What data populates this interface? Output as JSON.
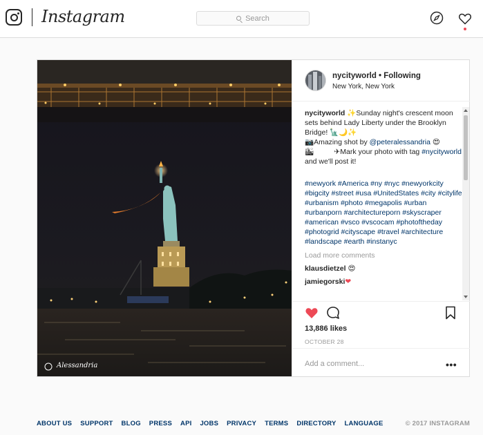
{
  "header": {
    "wordmark": "Instagram",
    "search_placeholder": "Search",
    "icons": [
      "instagram-camera-icon",
      "search-icon",
      "compass-icon",
      "heart-icon"
    ]
  },
  "post": {
    "photo_watermark": "Alessandria",
    "username": "nycityworld",
    "following": "• Following",
    "location": "New York, New York",
    "caption": {
      "username": "nycityworld",
      "line1": " ✨Sunday night's crescent moon sets behind Lady Liberty under the Brooklyn Bridge! 🗽🌙✨",
      "shot_prefix": "📷Amazing shot by ",
      "mention": "@peteralessandria",
      "shot_suffix": " 😍",
      "tag_prefix": "🏙          ✈Mark your photo with tag ",
      "tag_link": "#nycityworld",
      "tag_suffix": " and we'll post it!",
      "hashtags": "#newyork #America #ny #nyc #newyorkcity #bigcity #street #usa #UnitedStates #city #citylife #urbanism #photo #megapolis #urban #urbanporn #architectureporn #skyscraper #american #vsco #vscocam #photoftheday #photogrid #cityscape #travel #architecture #landscape #earth #instanyc"
    },
    "load_more": "Load more comments",
    "comments": [
      {
        "user": "klausdietzel",
        "text": " 😍"
      },
      {
        "user": "jamiegorski",
        "text": "❤"
      }
    ],
    "likes": "13,886 likes",
    "date": "OCTOBER 28",
    "add_comment_placeholder": "Add a comment...",
    "more_options": "•••",
    "like_color": "#ed4956"
  },
  "footer": {
    "links": [
      "ABOUT US",
      "SUPPORT",
      "BLOG",
      "PRESS",
      "API",
      "JOBS",
      "PRIVACY",
      "TERMS",
      "DIRECTORY",
      "LANGUAGE"
    ],
    "copyright": "© 2017 INSTAGRAM"
  }
}
